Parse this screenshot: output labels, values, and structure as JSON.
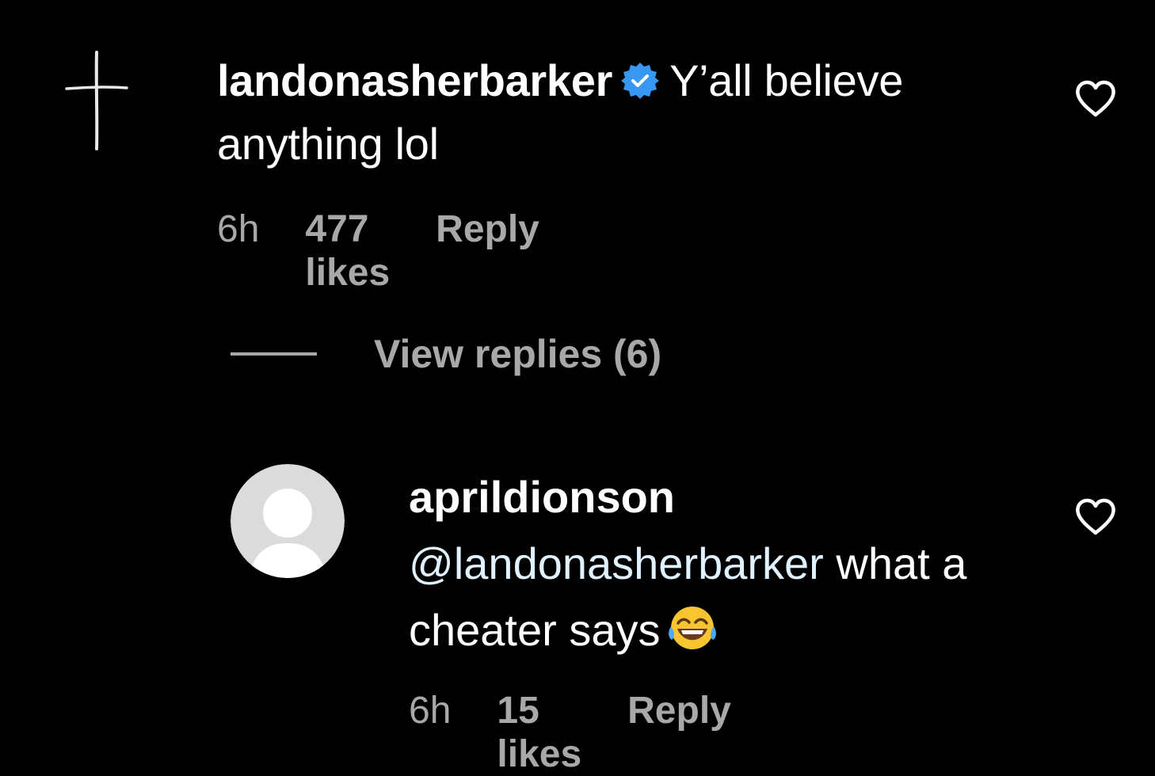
{
  "comment1": {
    "username": "landonasherbarker",
    "verified_icon": "verified-badge-icon",
    "text": "Y’all believe anything lol",
    "time": "6h",
    "likes": "477 likes",
    "reply_label": "Reply"
  },
  "view_replies": {
    "label": "View replies (6)"
  },
  "comment2": {
    "username": "aprildionson",
    "mention": "@landonasherbarker",
    "text": " what a cheater says",
    "emoji": "face-with-tears-of-joy",
    "time": "6h",
    "likes": "15 likes",
    "reply_label": "Reply"
  },
  "colors": {
    "background": "#000000",
    "text": "#ffffff",
    "muted": "#a8a8a8",
    "verified": "#3897f0",
    "mention": "#e0f1ff"
  }
}
